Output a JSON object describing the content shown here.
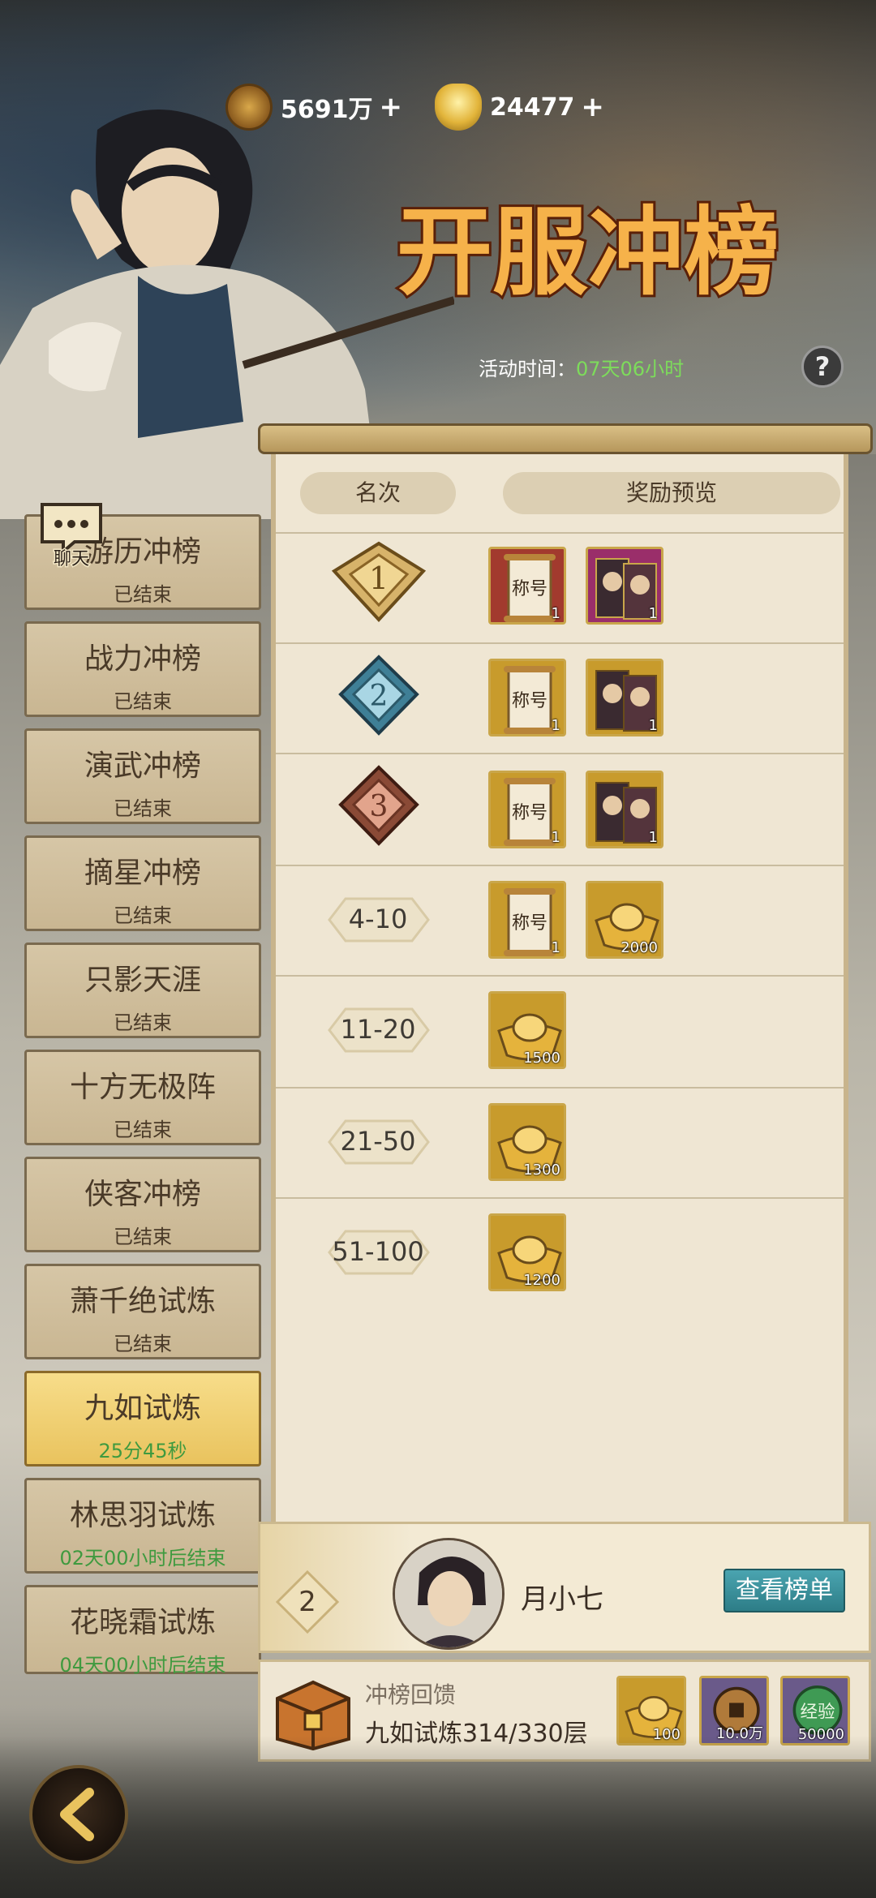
{
  "currency": {
    "coins": "5691万",
    "gold": "24477",
    "plus": "+"
  },
  "event": {
    "title": "开服冲榜",
    "time_label": "活动时间：",
    "time_value": "07天06小时",
    "help": "?"
  },
  "chat_label": "聊天",
  "tabs": [
    {
      "name": "游历冲榜",
      "status": "已结束"
    },
    {
      "name": "战力冲榜",
      "status": "已结束"
    },
    {
      "name": "演武冲榜",
      "status": "已结束"
    },
    {
      "name": "摘星冲榜",
      "status": "已结束"
    },
    {
      "name": "只影天涯",
      "status": "已结束"
    },
    {
      "name": "十方无极阵",
      "status": "已结束"
    },
    {
      "name": "侠客冲榜",
      "status": "已结束"
    },
    {
      "name": "萧千绝试炼",
      "status": "已结束"
    },
    {
      "name": "九如试炼",
      "status": "25分45秒"
    },
    {
      "name": "林思羽试炼",
      "status": "02天00小时后结束"
    },
    {
      "name": "花晓霜试炼",
      "status": "04天00小时后结束"
    }
  ],
  "table": {
    "rank_header": "名次",
    "reward_header": "奖励预览",
    "rows": [
      {
        "rank": "1",
        "rewards": [
          {
            "type": "title-scroll",
            "qty": "1",
            "label": "称号"
          },
          {
            "type": "hero-card",
            "qty": "1"
          }
        ]
      },
      {
        "rank": "2",
        "rewards": [
          {
            "type": "title-scroll",
            "qty": "1",
            "label": "称号"
          },
          {
            "type": "hero-card",
            "qty": "1"
          }
        ]
      },
      {
        "rank": "3",
        "rewards": [
          {
            "type": "title-scroll",
            "qty": "1",
            "label": "称号"
          },
          {
            "type": "hero-card",
            "qty": "1"
          }
        ]
      },
      {
        "rank": "4-10",
        "rewards": [
          {
            "type": "title-scroll",
            "qty": "1",
            "label": "称号"
          },
          {
            "type": "gold-ingot",
            "qty": "2000"
          }
        ]
      },
      {
        "rank": "11-20",
        "rewards": [
          {
            "type": "gold-ingot",
            "qty": "1500"
          }
        ]
      },
      {
        "rank": "21-50",
        "rewards": [
          {
            "type": "gold-ingot",
            "qty": "1300"
          }
        ]
      },
      {
        "rank": "51-100",
        "rewards": [
          {
            "type": "gold-ingot",
            "qty": "1200"
          }
        ]
      }
    ]
  },
  "me": {
    "rank": "2",
    "name": "月小七",
    "view_button": "查看榜单"
  },
  "feedback": {
    "title": "冲榜回馈",
    "progress": "九如试炼314/330层",
    "rewards": [
      {
        "type": "gold-ingot",
        "qty": "100"
      },
      {
        "type": "copper-coin",
        "qty": "10.0万"
      },
      {
        "type": "exp-orb",
        "qty": "50000",
        "label": "经验"
      }
    ]
  }
}
